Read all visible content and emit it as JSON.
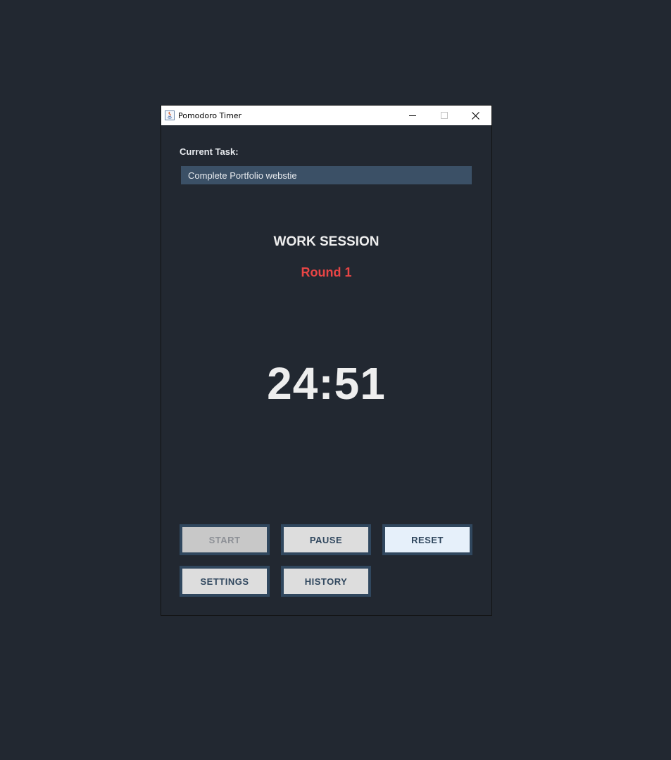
{
  "window": {
    "title": "Pomodoro Timer",
    "controls": {
      "minimize": "minimize-icon",
      "maximize": "maximize-icon",
      "close": "close-icon"
    }
  },
  "task": {
    "label": "Current Task:",
    "value": "Complete Portfolio webstie"
  },
  "session": {
    "type": "WORK SESSION",
    "round": "Round 1",
    "time_remaining": "24:51"
  },
  "buttons": {
    "start": "START",
    "pause": "PAUSE",
    "reset": "RESET",
    "settings": "SETTINGS",
    "history": "HISTORY"
  },
  "colors": {
    "background": "#222831",
    "input_background": "#3b5066",
    "button_border": "#30475e",
    "round_accent": "#e84545",
    "text": "#eeeeee"
  }
}
